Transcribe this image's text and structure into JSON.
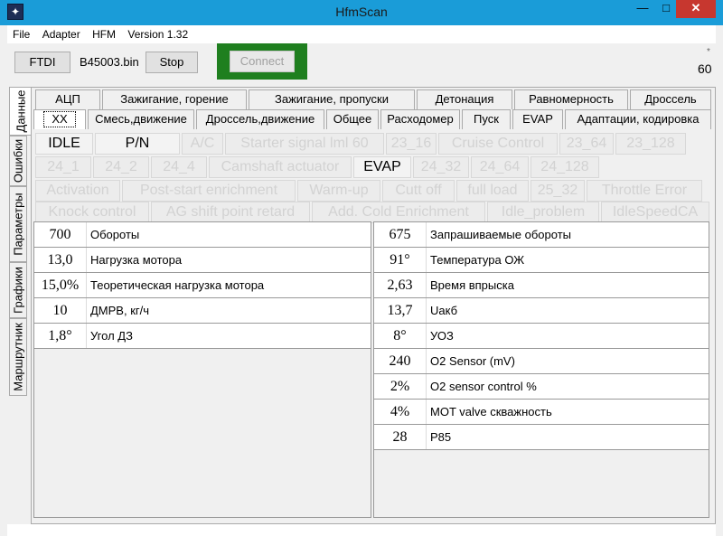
{
  "window": {
    "title": "HfmScan",
    "minimize_label": "—",
    "maximize_label": "□",
    "close_label": "✕"
  },
  "menu": [
    "File",
    "Adapter",
    "HFM",
    "Version 1.32"
  ],
  "toolbar": {
    "ftdi_label": "FTDI",
    "file_name": "B45003.bin",
    "stop_label": "Stop",
    "connect_label": "Connect",
    "connect_frame_color": "#1f7f1f",
    "star": "*",
    "count": "60"
  },
  "side_tabs": [
    "Данные",
    "Ошибки",
    "Параметры",
    "Графики",
    "Маршрутник"
  ],
  "tabs_row1": [
    "АЦП",
    "Зажигание, горение",
    "Зажигание, пропуски",
    "Детонация",
    "Равномерность",
    "Дроссель"
  ],
  "tabs_row2": [
    "XX",
    "Смесь,движение",
    "Дроссель,движение",
    "Общее",
    "Расходомер",
    "Пуск",
    "EVAP",
    "Адаптации, кодировка"
  ],
  "flags_row1": [
    {
      "label": "IDLE",
      "on": true
    },
    {
      "label": "P/N",
      "on": true
    },
    {
      "label": "A/C",
      "on": false
    },
    {
      "label": "Starter signal lml 60",
      "on": false
    },
    {
      "label": "23_16",
      "on": false
    },
    {
      "label": "Cruise Control",
      "on": false
    },
    {
      "label": "23_64",
      "on": false
    },
    {
      "label": "23_128",
      "on": false
    }
  ],
  "flags_row2": [
    {
      "label": "24_1",
      "on": false
    },
    {
      "label": "24_2",
      "on": false
    },
    {
      "label": "24_4",
      "on": false
    },
    {
      "label": "Camshaft actuator",
      "on": false
    },
    {
      "label": "EVAP",
      "on": true
    },
    {
      "label": "24_32",
      "on": false
    },
    {
      "label": "24_64",
      "on": false
    },
    {
      "label": "24_128",
      "on": false
    }
  ],
  "flags_row3": [
    {
      "label": "Activation",
      "on": false
    },
    {
      "label": "Post-start enrichment",
      "on": false
    },
    {
      "label": "Warm-up",
      "on": false
    },
    {
      "label": "Cutt off",
      "on": false
    },
    {
      "label": "full load",
      "on": false
    },
    {
      "label": "25_32",
      "on": false
    },
    {
      "label": "Throttle Error",
      "on": false
    }
  ],
  "flags_row4": [
    {
      "label": "Knock control",
      "on": false
    },
    {
      "label": "AG shift point retard",
      "on": false
    },
    {
      "label": "Add. Cold Enrichment",
      "on": false
    },
    {
      "label": "Idle_problem",
      "on": false
    },
    {
      "label": "IdleSpeedCA",
      "on": false
    }
  ],
  "params_left": [
    {
      "value": "700",
      "label": "Обороты"
    },
    {
      "value": "13,0",
      "label": "Нагрузка мотора"
    },
    {
      "value": "15,0%",
      "label": "Теоретическая нагрузка мотора"
    },
    {
      "value": "10",
      "label": "ДМРВ, кг/ч"
    },
    {
      "value": "1,8°",
      "label": "Угол ДЗ"
    }
  ],
  "params_right": [
    {
      "value": "675",
      "label": "Запрашиваемые обороты"
    },
    {
      "value": "91°",
      "label": "Температура ОЖ"
    },
    {
      "value": "2,63",
      "label": "Время впрыска"
    },
    {
      "value": "13,7",
      "label": "Uакб"
    },
    {
      "value": "8°",
      "label": "УОЗ"
    },
    {
      "value": "240",
      "label": "O2 Sensor (mV)"
    },
    {
      "value": "2%",
      "label": "O2 sensor control %"
    },
    {
      "value": "4%",
      "label": "MOT valve скважность"
    },
    {
      "value": "28",
      "label": "P85"
    }
  ]
}
